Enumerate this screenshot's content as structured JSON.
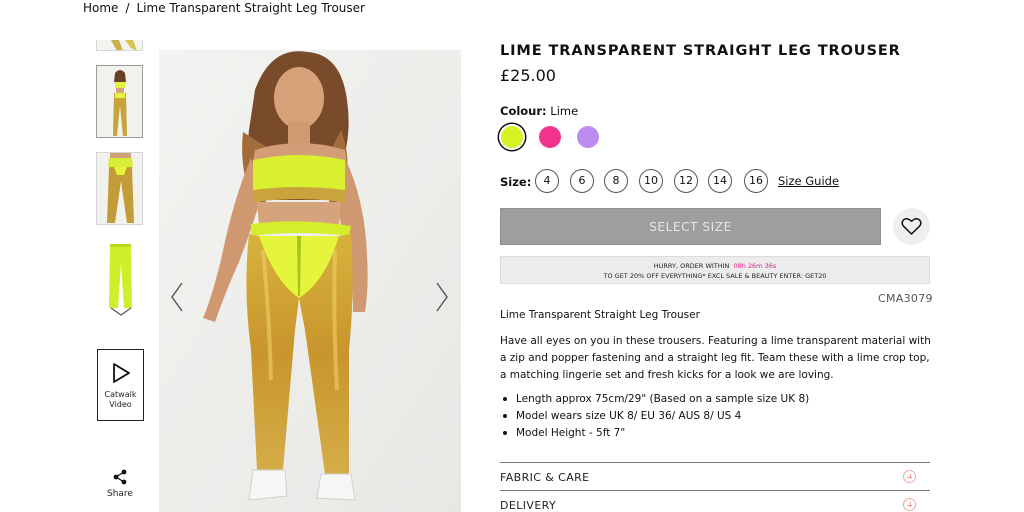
{
  "breadcrumb": {
    "home": "Home",
    "separator": "/",
    "current": "Lime Transparent Straight Leg Trouser"
  },
  "gallery": {
    "catwalk_label_line1": "Catwalk",
    "catwalk_label_line2": "Video",
    "share_label": "Share"
  },
  "product": {
    "title": "LIME TRANSPARENT STRAIGHT LEG TROUSER",
    "price": "£25.00",
    "colour_label": "Colour:",
    "colour_selected": "Lime",
    "colours": [
      {
        "name": "Lime",
        "hex": "#d7f224"
      },
      {
        "name": "Pink",
        "hex": "#f0338b"
      },
      {
        "name": "Lilac",
        "hex": "#bd8cf0"
      }
    ],
    "size_label": "Size:",
    "sizes": [
      "4",
      "6",
      "8",
      "10",
      "12",
      "14",
      "16"
    ],
    "size_guide": "Size Guide",
    "select_size_button": "SELECT SIZE",
    "promo_line1": "HURRY, ORDER WITHIN",
    "promo_timer": "08h 26m 36s",
    "promo_line2": "TO GET 20% OFF EVERYTHING* EXCL SALE & BEAUTY ENTER: GET20",
    "sku": "CMA3079",
    "desc_title": "Lime Transparent Straight Leg Trouser",
    "description": "Have all eyes on you in these trousers. Featuring a lime transparent material with a zip and popper fastening and a straight leg fit. Team these with a lime crop top, a matching lingerie set and fresh kicks for a look we are loving.",
    "bullets": [
      "Length approx 75cm/29\" (Based on a sample size UK 8)",
      "Model wears size UK 8/ EU 36/ AUS 8/ US 4",
      "Model Height - 5ft 7\""
    ],
    "accordion": [
      "FABRIC & CARE",
      "DELIVERY"
    ]
  },
  "colors": {
    "accent_pink": "#e0208c",
    "button_grey": "#9e9e9e"
  }
}
